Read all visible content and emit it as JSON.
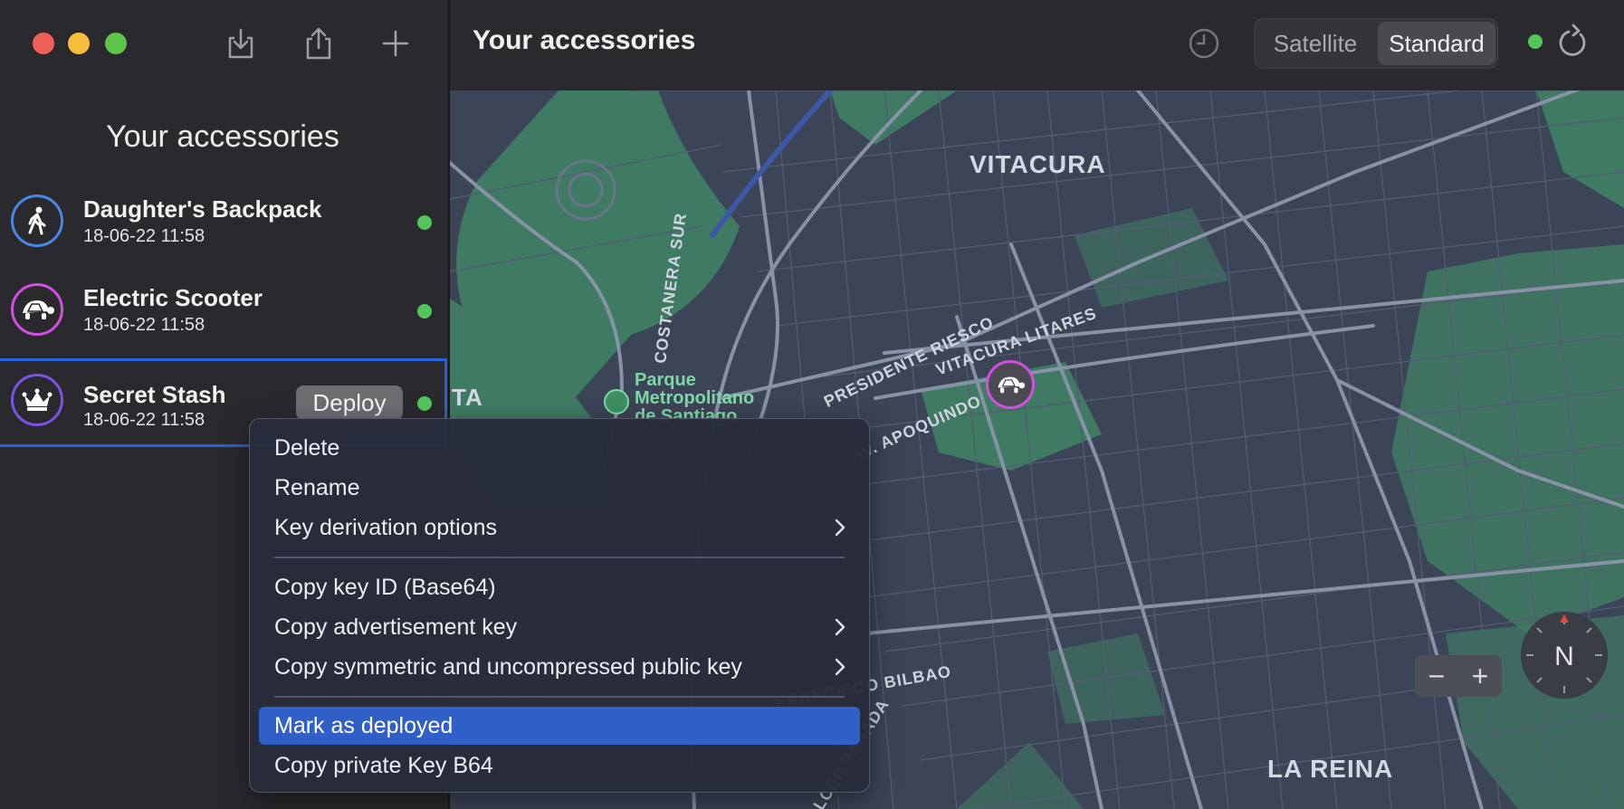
{
  "sidebar": {
    "title": "Your accessories",
    "accessories": [
      {
        "name": "Daughter's Backpack",
        "date": "18-06-22 11:58",
        "ring_color": "#4a86e8",
        "icon": "walking-person-icon"
      },
      {
        "name": "Electric Scooter",
        "date": "18-06-22 11:58",
        "ring_color": "#d24fe0",
        "icon": "tortoise-icon"
      },
      {
        "name": "Secret Stash",
        "date": "18-06-22 11:58",
        "ring_color": "#7a52e6",
        "icon": "crown-icon",
        "deploy_label": "Deploy"
      }
    ]
  },
  "header": {
    "title": "Your accessories",
    "map_type_options": [
      "Satellite",
      "Standard"
    ],
    "selected_map_type": "Standard"
  },
  "map": {
    "districts": [
      "VITACURA",
      "LA REINA",
      "TA"
    ],
    "streets": [
      "COSTANERA SUR",
      "PRESIDENTE RIESCO",
      "VITACURA LITARES",
      "AV. APOQUINDO",
      "FRANCISCO BILBAO",
      "ALCER PARADA"
    ],
    "park": [
      "Parque",
      "Metropolitano",
      "de Santiago"
    ],
    "compass": "N",
    "zoom_out": "−",
    "zoom_in": "+"
  },
  "context_menu": {
    "items": [
      {
        "label": "Delete"
      },
      {
        "label": "Rename"
      },
      {
        "label": "Key derivation options",
        "submenu": true
      },
      {
        "label": "Copy key ID (Base64)"
      },
      {
        "label": "Copy advertisement key",
        "submenu": true
      },
      {
        "label": "Copy symmetric and uncompressed public key",
        "submenu": true
      },
      {
        "label": "Mark as deployed",
        "highlighted": true
      },
      {
        "label": "Copy private Key B64"
      }
    ]
  },
  "colors": {
    "accent": "#2f5fc7",
    "status_green": "#52c55a",
    "map_base": "#3c4457",
    "map_park": "#3f7a63"
  }
}
